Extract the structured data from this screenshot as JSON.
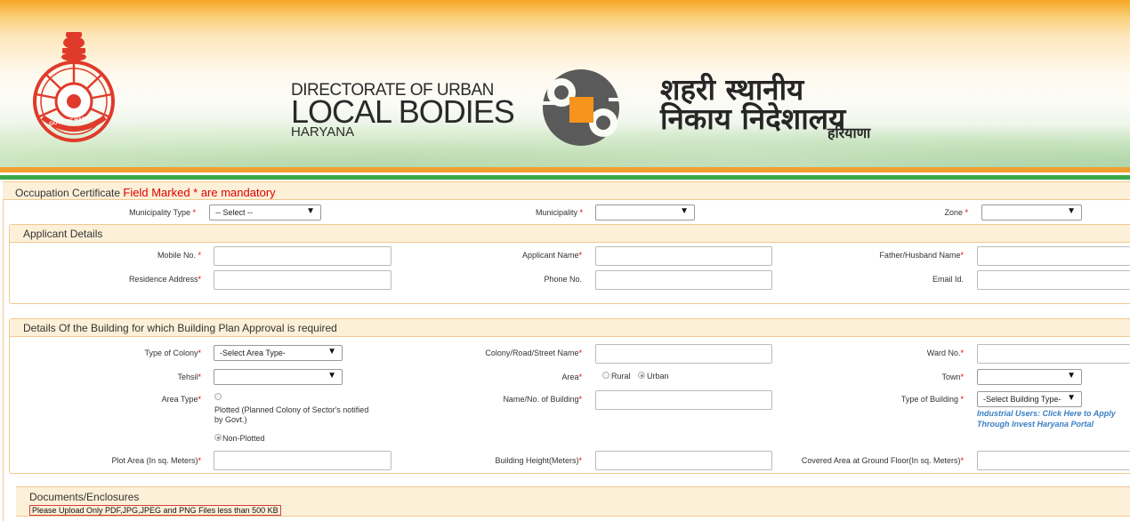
{
  "banner": {
    "emblem_text": "GOVT OF HARYANA",
    "en_line1": "DIRECTORATE OF URBAN",
    "en_line2": "LOCAL BODIES",
    "en_line3": "HARYANA",
    "hi_line1": "शहरी स्थानीय",
    "hi_line2": "निकाय निदेशालय",
    "hi_line3": "हरियाणा",
    "colors": {
      "saffron": "#f5a623",
      "green": "#3aa84a",
      "logo_orange": "#f7941d",
      "logo_gray": "#5a5a5a"
    }
  },
  "form": {
    "title": "Occupation Certificate",
    "mandatory_note": "Field Marked * are mandatory",
    "star": "*",
    "top_row": {
      "municipality_type_label": "Municipality Type",
      "municipality_type_value": "-- Select --",
      "municipality_label": "Municipality",
      "municipality_value": "",
      "zone_label": "Zone",
      "zone_value": ""
    },
    "applicant": {
      "heading": "Applicant Details",
      "mobile_label": "Mobile No.",
      "applicant_name_label": "Applicant Name",
      "father_label": "Father/Husband Name",
      "residence_label": "Residence Address",
      "phone_label": "Phone No.",
      "email_label": "Email Id."
    },
    "building": {
      "heading": "Details Of the Building for which Building Plan Approval is required",
      "colony_type_label": "Type of Colony",
      "colony_type_value": "-Select Area Type-",
      "colony_road_label": "Colony/Road/Street Name",
      "ward_label": "Ward No.",
      "tehsil_label": "Tehsil",
      "tehsil_value": "",
      "area_label": "Area",
      "area_rural": "Rural",
      "area_urban": "Urban",
      "town_label": "Town",
      "town_value": "",
      "area_type_label": "Area Type",
      "plotted_line1": "Plotted (Planned Colony of Sector's notified",
      "plotted_line2": "by Govt.)",
      "non_plotted": "Non-Plotted",
      "building_name_label": "Name/No. of Building",
      "building_type_label": "Type of Building",
      "building_type_value": "-Select Building Type-",
      "invest_link_line1": "Industrial Users: Click Here to Apply",
      "invest_link_line2": "Through Invest Haryana Portal",
      "plot_area_label": "Plot Area (In sq. Meters)",
      "height_label": "Building Height(Meters)",
      "covered_label": "Covered Area at Ground Floor(In sq. Meters)"
    },
    "documents": {
      "heading": "Documents/Enclosures",
      "note": "Please Upload Only PDF,JPG,JPEG and PNG Files less than 500 KB"
    }
  }
}
